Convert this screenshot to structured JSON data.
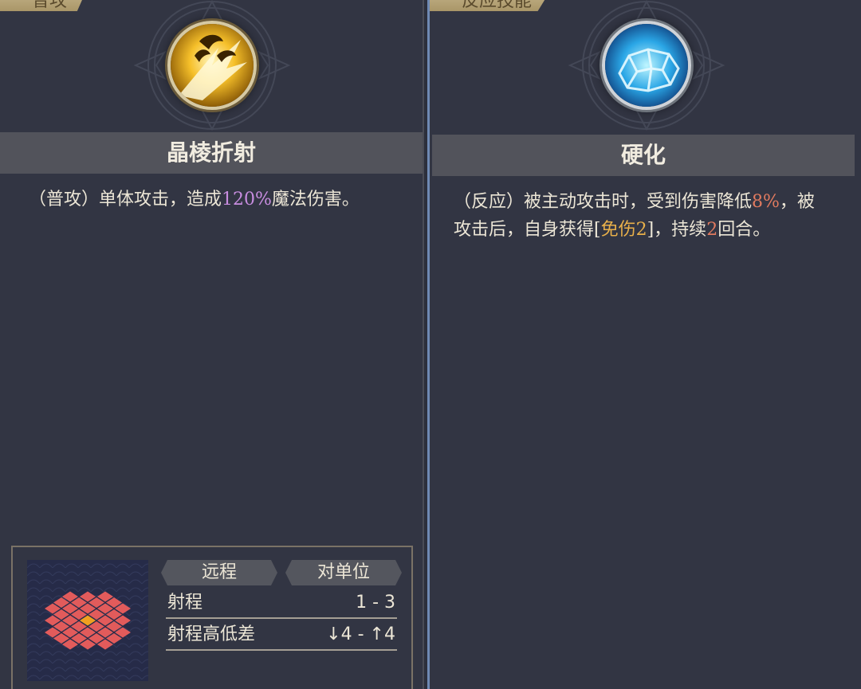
{
  "left_panel": {
    "category_tab": "普攻",
    "skill_icon": "golden-claw-strike-icon",
    "skill_name": "晶棱折射",
    "description": {
      "prefix": "（普攻）单体攻击，造成",
      "damage_value": "120%",
      "suffix": "魔法伤害。"
    },
    "range": {
      "attack_type": "远程",
      "target_type": "对单位",
      "range_label": "射程",
      "range_value": "1 - 3",
      "height_label": "射程高低差",
      "height_value": "↓4 - ↑4",
      "grid_icon": "attack-range-grid-icon"
    }
  },
  "right_panel": {
    "category_tab": "反应技能",
    "skill_icon": "crystal-shield-icon",
    "skill_name": "硬化",
    "description": {
      "part1": "（反应）被主动攻击时，受到伤害降低",
      "reduction_value": "8%",
      "part2": "，被攻击后，自身获得[",
      "buff_name": "免伤2",
      "part3": "]，持续",
      "duration_value": "2",
      "part4": "回合。"
    }
  },
  "colors": {
    "panel_bg": "#323543",
    "title_bar_bg": "#52535b",
    "highlight_purple": "#c88de0",
    "highlight_red": "#e07a5f",
    "highlight_gold": "#e8b04a",
    "range_tile": "#e25b5b",
    "range_center_tile": "#f0a020",
    "divider_blue": "#6f89b3"
  }
}
